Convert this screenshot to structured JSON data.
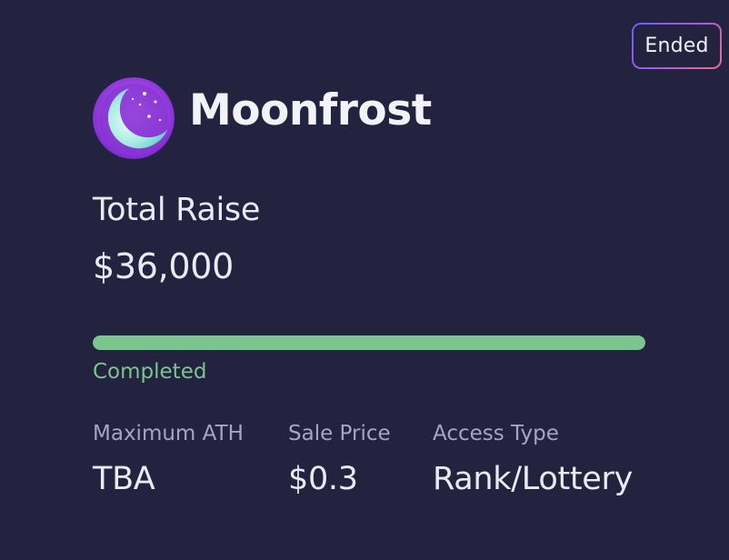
{
  "status_badge": "Ended",
  "project": {
    "name": "Moonfrost",
    "logo_icon": "moon-logo-icon"
  },
  "raise": {
    "label": "Total Raise",
    "value": "$36,000"
  },
  "progress": {
    "fraction": 1.0,
    "status": "Completed",
    "color": "#7ac68e"
  },
  "stats": [
    {
      "label": "Maximum ATH",
      "value": "TBA"
    },
    {
      "label": "Sale Price",
      "value": "$0.3"
    },
    {
      "label": "Access Type",
      "value": "Rank/Lottery"
    }
  ],
  "colors": {
    "background": "#23233f",
    "badge_gradient": [
      "#6b5cff",
      "#a45be6",
      "#ef6a8a"
    ],
    "logo": "#8e3ad6"
  }
}
